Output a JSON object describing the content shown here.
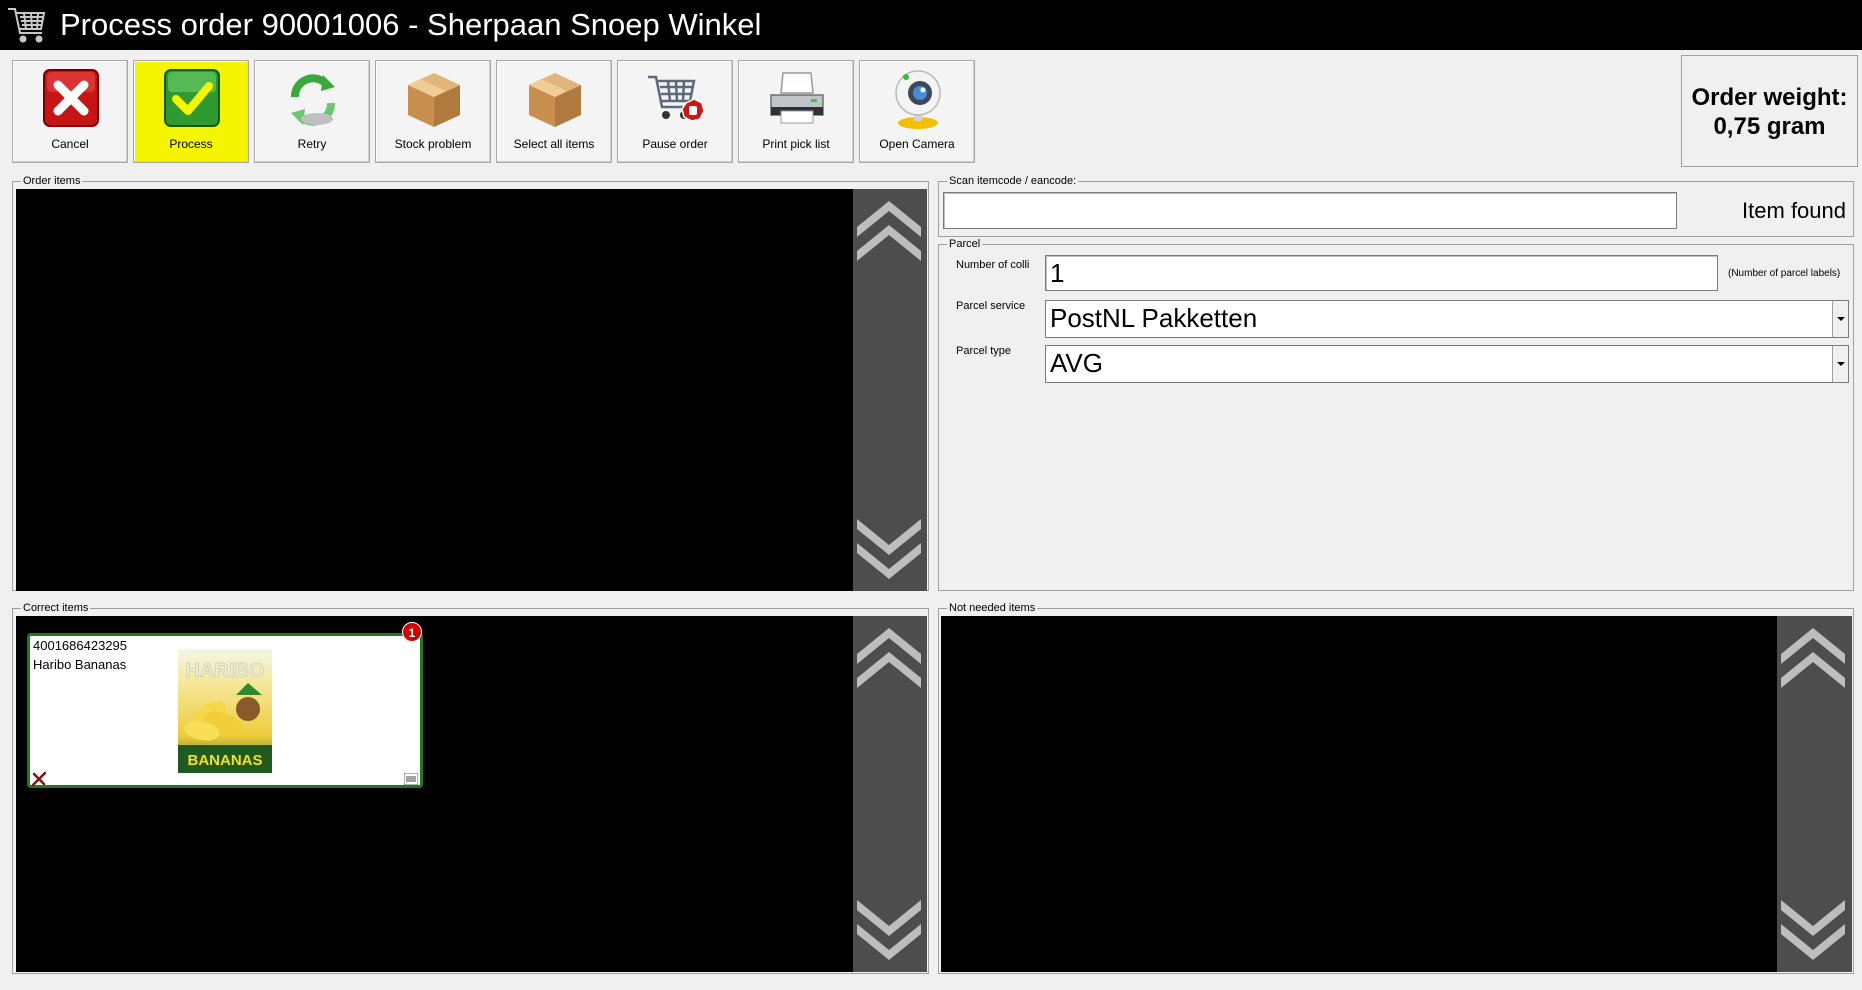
{
  "window": {
    "title": "Process order 90001006 - Sherpaan Snoep Winkel",
    "icon": "shopping-cart-icon"
  },
  "toolbar": [
    {
      "label": "Cancel",
      "icon": "cancel-icon"
    },
    {
      "label": "Process",
      "icon": "check-icon",
      "active": true
    },
    {
      "label": "Retry",
      "icon": "retry-icon"
    },
    {
      "label": "Stock problem",
      "icon": "box-icon"
    },
    {
      "label": "Select all items",
      "icon": "box-icon"
    },
    {
      "label": "Pause order",
      "icon": "cart-stop-icon"
    },
    {
      "label": "Print pick list",
      "icon": "printer-icon"
    },
    {
      "label": "Open Camera",
      "icon": "webcam-icon"
    }
  ],
  "order_weight": {
    "label": "Order weight:",
    "value": "0,75 gram"
  },
  "order_items": {
    "legend": "Order items"
  },
  "scan": {
    "legend": "Scan itemcode / eancode:",
    "value": "",
    "status": "Item found"
  },
  "parcel": {
    "legend": "Parcel",
    "colli_label": "Number of colli",
    "colli_value": "1",
    "colli_hint": "(Number of parcel labels)",
    "service_label": "Parcel service",
    "service_value": "PostNL Pakketten",
    "type_label": "Parcel type",
    "type_value": "AVG"
  },
  "correct_items": {
    "legend": "Correct items",
    "items": [
      {
        "code": "4001686423295",
        "name": "Haribo Bananas",
        "count": "1",
        "brand": "HARIBO",
        "product": "BANANAS"
      }
    ]
  },
  "not_needed_items": {
    "legend": "Not needed items"
  },
  "colors": {
    "title_bg": "#000000",
    "active_button": "#f5f500",
    "card_border": "#1d7a1d",
    "badge": "#d40000"
  }
}
